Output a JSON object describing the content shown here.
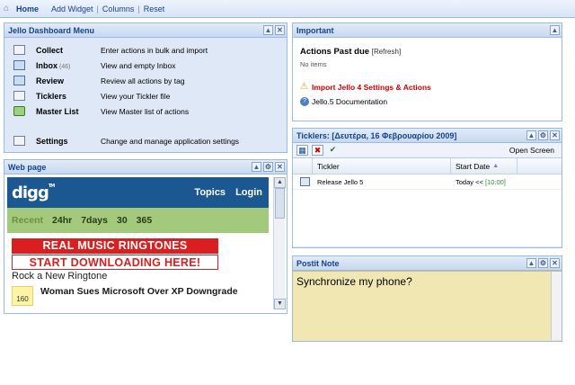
{
  "topbar": {
    "home": "Home",
    "add_widget": "Add Widget",
    "columns": "Columns",
    "reset": "Reset",
    "sep": "|"
  },
  "jello_menu": {
    "title": "Jello Dashboard Menu",
    "items": [
      {
        "label": "Collect",
        "count": "",
        "desc": "Enter actions in bulk and import",
        "icon": "collect-icon"
      },
      {
        "label": "Inbox",
        "count": "(46)",
        "desc": "View and empty Inbox",
        "icon": "inbox-icon"
      },
      {
        "label": "Review",
        "count": "",
        "desc": "Review all actions by tag",
        "icon": "review-icon"
      },
      {
        "label": "Ticklers",
        "count": "",
        "desc": "View your Tickler file",
        "icon": "ticklers-icon"
      },
      {
        "label": "Master List",
        "count": "",
        "desc": "View Master list of actions",
        "icon": "master-list-icon"
      },
      {
        "label": "Settings",
        "count": "",
        "desc": "Change and manage application settings",
        "icon": "settings-icon"
      }
    ]
  },
  "important": {
    "title": "Important",
    "past_due": "Actions Past due",
    "refresh": "[Refresh]",
    "no_items": "No items",
    "import_link": "Import Jello 4 Settings & Actions",
    "doc_link": "Jello.5 Documentation"
  },
  "ticklers": {
    "title": "Ticklers: [Δευτέρα, 16 Φεβρουαρίου 2009]",
    "open_screen": "Open Screen",
    "columns": [
      "Tickler",
      "Start Date"
    ],
    "rows": [
      {
        "name": "Release Jello 5",
        "date": "Today <<",
        "time": "[10:00]"
      }
    ]
  },
  "webpage": {
    "title": "Web page",
    "digg": {
      "logo": "digg",
      "tm": "TM",
      "nav": [
        "Topics",
        "Login"
      ],
      "filters": [
        "Recent",
        "24hr",
        "7days",
        "30",
        "365"
      ],
      "ad_line1": "REAL MUSIC RINGTONES",
      "ad_line2": "START DOWNLOADING HERE!",
      "ringtone": "Rock a New Ringtone",
      "story_count": "160",
      "story_title": "Woman Sues Microsoft Over XP Downgrade"
    }
  },
  "postit": {
    "title": "Postit Note",
    "text": "Synchronize my phone?"
  },
  "colors": {
    "panel_border": "#99bbe8",
    "header_text": "#15428b",
    "digg_blue": "#1b5790",
    "digg_green": "#a3c97c",
    "postit_bg": "#f0e7b3",
    "alert_red": "#cc0000"
  }
}
